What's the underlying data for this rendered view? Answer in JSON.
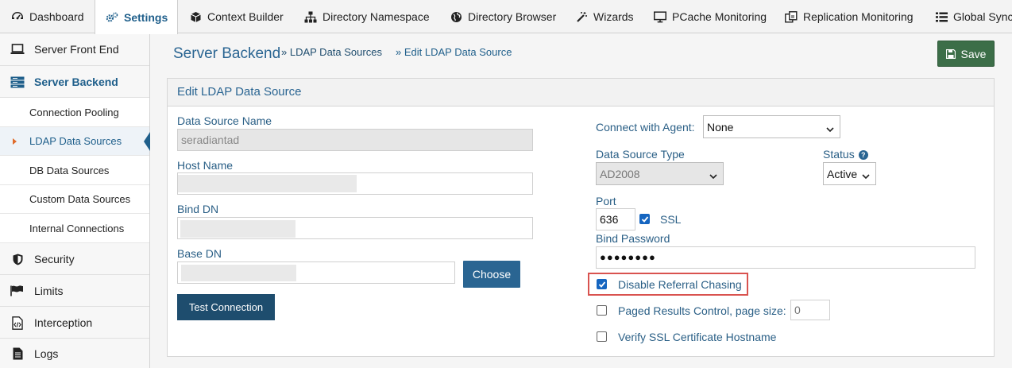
{
  "nav": {
    "tabs": [
      {
        "label": "Dashboard",
        "icon": "dashboard-icon"
      },
      {
        "label": "Settings",
        "icon": "gears-icon",
        "active": true
      },
      {
        "label": "Context Builder",
        "icon": "cube-icon"
      },
      {
        "label": "Directory Namespace",
        "icon": "sitemap-icon"
      },
      {
        "label": "Directory Browser",
        "icon": "globe-icon"
      },
      {
        "label": "Wizards",
        "icon": "magic-wand-icon"
      },
      {
        "label": "PCache Monitoring",
        "icon": "monitor-icon"
      },
      {
        "label": "Replication Monitoring",
        "icon": "replication-icon"
      },
      {
        "label": "Global Sync",
        "icon": "list-icon"
      }
    ]
  },
  "sidebar": {
    "items": [
      {
        "label": "Server Front End",
        "icon": "laptop-icon"
      },
      {
        "label": "Server Backend",
        "icon": "server-icon",
        "active": true
      },
      {
        "label": "Security",
        "icon": "shield-icon"
      },
      {
        "label": "Limits",
        "icon": "flag-icon"
      },
      {
        "label": "Interception",
        "icon": "code-file-icon"
      },
      {
        "label": "Logs",
        "icon": "document-icon"
      }
    ],
    "subitems": [
      {
        "label": "Connection Pooling"
      },
      {
        "label": "LDAP Data Sources",
        "active": true
      },
      {
        "label": "DB Data Sources"
      },
      {
        "label": "Custom Data Sources"
      },
      {
        "label": "Internal Connections"
      }
    ]
  },
  "header": {
    "title": "Server Backend",
    "breadcrumb": [
      "» LDAP Data Sources",
      "» Edit LDAP Data Source"
    ],
    "save_label": "Save"
  },
  "panel": {
    "title": "Edit LDAP Data Source",
    "data_source_name": {
      "label": "Data Source Name",
      "value": "seradiantad"
    },
    "host_name": {
      "label": "Host Name",
      "value": ""
    },
    "bind_dn": {
      "label": "Bind DN",
      "value": ""
    },
    "base_dn": {
      "label": "Base DN",
      "value": ""
    },
    "choose_label": "Choose",
    "test_connection_label": "Test Connection",
    "connect_with_agent": {
      "label": "Connect with Agent:",
      "value": "None"
    },
    "data_source_type": {
      "label": "Data Source Type",
      "value": "AD2008"
    },
    "status": {
      "label": "Status",
      "value": "Active"
    },
    "port": {
      "label": "Port",
      "value": "636"
    },
    "ssl": {
      "label": "SSL",
      "checked": true
    },
    "bind_password": {
      "label": "Bind Password",
      "value": "●●●●●●●●"
    },
    "disable_referral_chasing": {
      "label": "Disable Referral Chasing",
      "checked": true
    },
    "paged_results": {
      "label": "Paged Results Control, page size:",
      "checked": false,
      "placeholder": "0"
    },
    "verify_ssl": {
      "label": "Verify SSL Certificate Hostname",
      "checked": false
    }
  },
  "colors": {
    "accent": "#2a6592",
    "save_button": "#3c6e48",
    "highlight": "#d9534f",
    "checkbox": "#1565c0"
  }
}
